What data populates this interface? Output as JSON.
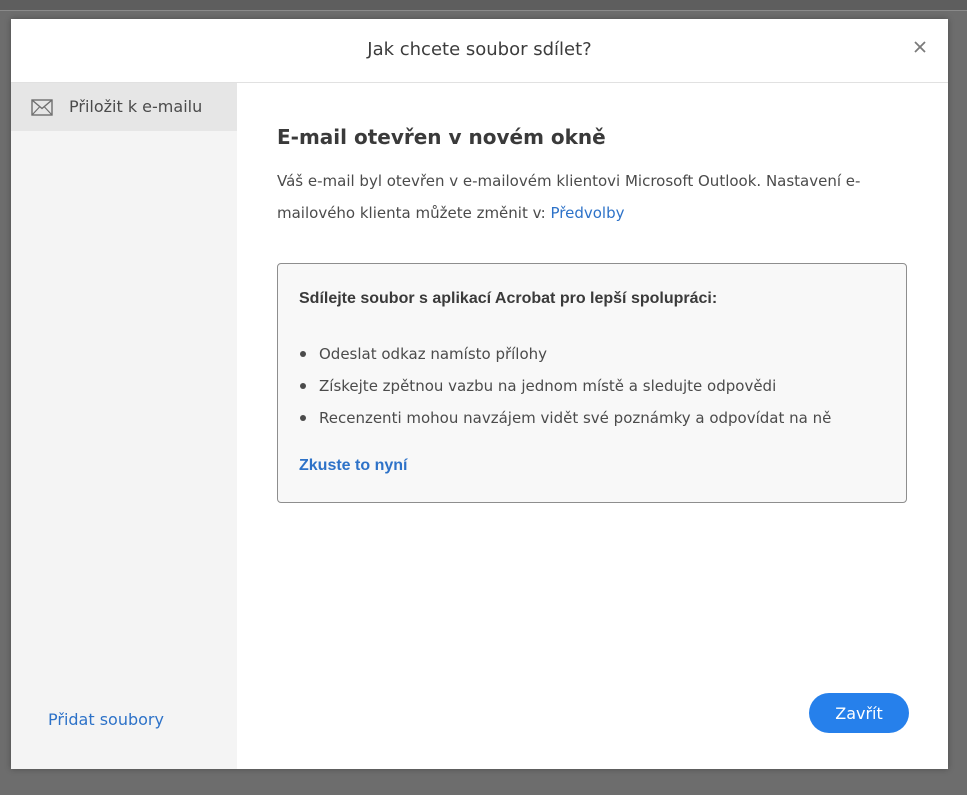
{
  "dialog": {
    "title": "Jak chcete soubor sdílet?",
    "close_icon": "close-icon"
  },
  "sidebar": {
    "items": [
      {
        "label": "Přiložit k e-mailu",
        "icon": "envelope-icon"
      }
    ],
    "add_files_label": "Přidat soubory"
  },
  "main": {
    "heading": "E-mail otevřen v novém okně",
    "description_text": "Váš e-mail byl otevřen v e-mailovém klientovi Microsoft Outlook. Nastavení e-mailového klienta můžete změnit v: ",
    "preferences_link": "Předvolby",
    "promo": {
      "heading": "Sdílejte soubor s aplikací Acrobat pro lepší spolupráci:",
      "items": [
        "Odeslat odkaz namísto přílohy",
        "Získejte zpětnou vazbu na jednom místě a sledujte odpovědi",
        "Recenzenti mohou navzájem vidět své poznámky a odpovídat na ně"
      ],
      "cta_label": "Zkuste to nyní"
    },
    "close_button_label": "Zavřít"
  },
  "colors": {
    "accent": "#2680eb",
    "link": "#2d72c8",
    "sidebar_bg": "#f4f4f4",
    "sidebar_selected_bg": "#e6e6e6"
  }
}
